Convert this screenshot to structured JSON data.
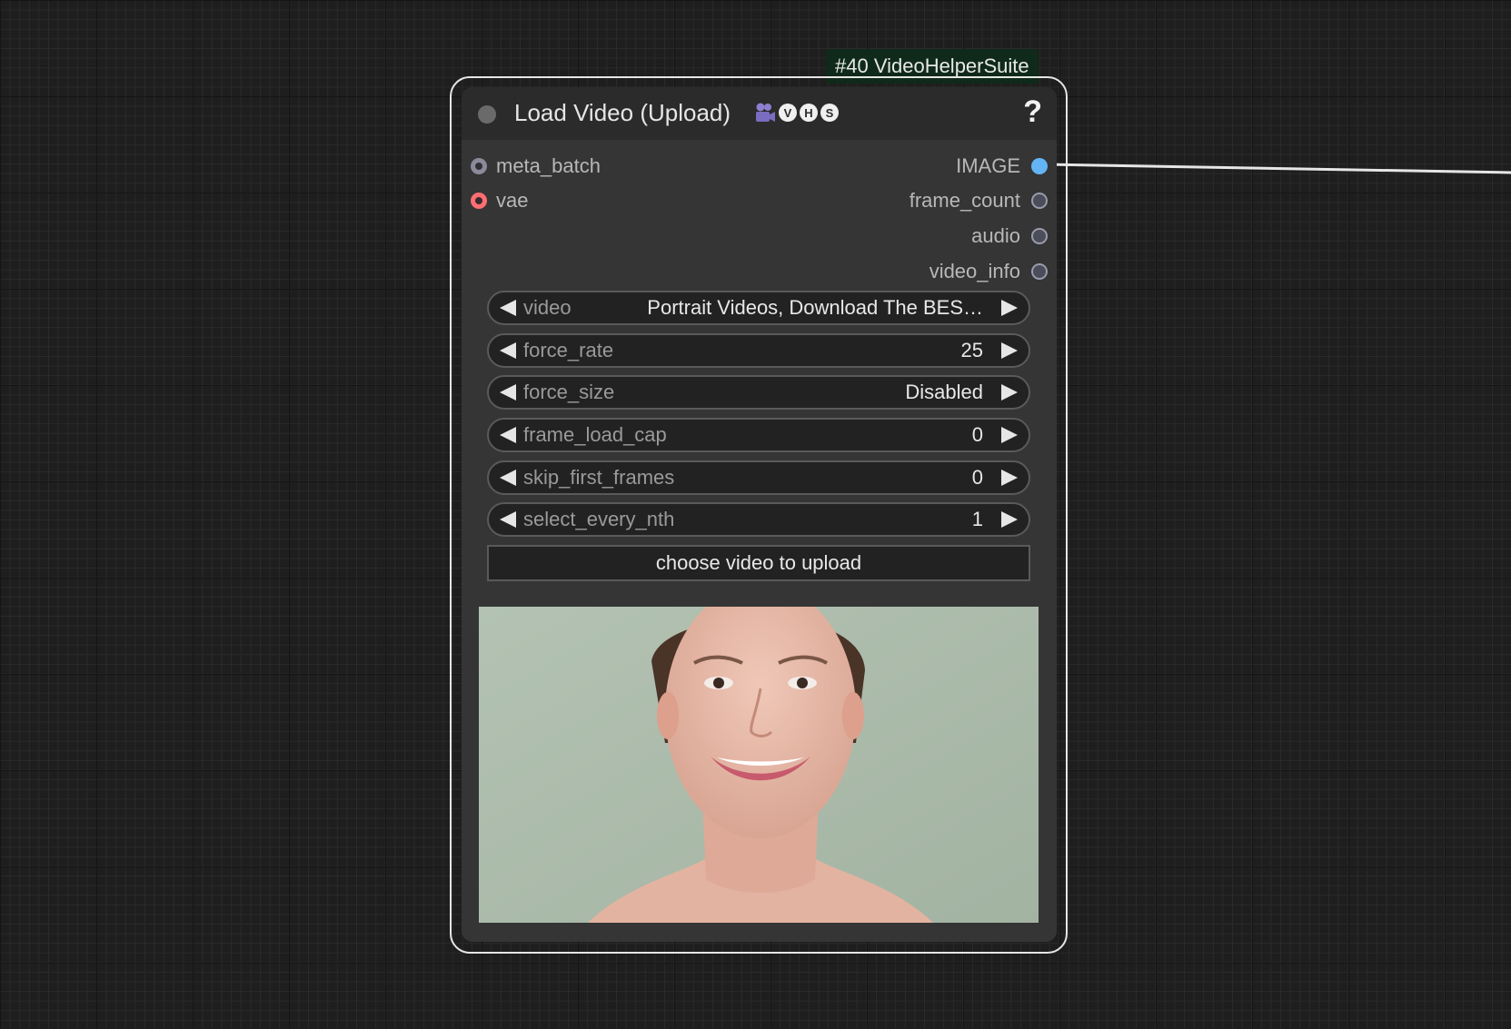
{
  "node": {
    "id_badge": "#40 VideoHelperSuite",
    "title": "Load Video (Upload)",
    "title_badges": [
      "camera-icon",
      "V",
      "H",
      "S"
    ],
    "help_label": "?",
    "inputs": [
      {
        "name": "meta_batch",
        "color": "#8a8a9a"
      },
      {
        "name": "vae",
        "color": "#ff6e73"
      }
    ],
    "outputs": [
      {
        "name": "IMAGE",
        "color": "#64b5f6",
        "connected": true
      },
      {
        "name": "frame_count",
        "color": "#4a4d5a"
      },
      {
        "name": "audio",
        "color": "#4a4d5a"
      },
      {
        "name": "video_info",
        "color": "#4a4d5a"
      }
    ],
    "widgets": [
      {
        "label": "video",
        "value": "Portrait Videos, Download The BES…"
      },
      {
        "label": "force_rate",
        "value": "25"
      },
      {
        "label": "force_size",
        "value": "Disabled"
      },
      {
        "label": "frame_load_cap",
        "value": "0"
      },
      {
        "label": "skip_first_frames",
        "value": "0"
      },
      {
        "label": "select_every_nth",
        "value": "1"
      }
    ],
    "upload_button_label": "choose video to upload",
    "preview_icon": "video-preview-portrait"
  },
  "colors": {
    "canvas_bg": "#1e1e1e",
    "node_bg": "#353535",
    "node_header": "#2b2b2b",
    "id_badge_bg": "#0f2a1a",
    "link_wire": "#e6e6e6"
  }
}
